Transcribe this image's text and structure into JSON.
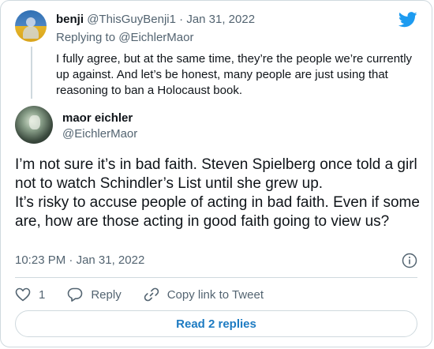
{
  "parent_tweet": {
    "name": "benji",
    "handle": "@ThisGuyBenji1",
    "separator": "·",
    "date": "Jan 31, 2022",
    "replying_label": "Replying to",
    "replying_handle": "@EichlerMaor",
    "text": "I fully agree, but at the same time, they’re the people we’re currently up against. And let’s be honest, many people are just using that reasoning to ban a Holocaust book."
  },
  "main_tweet": {
    "name": "maor eichler",
    "handle": "@EichlerMaor",
    "paragraphs": [
      "I’m not sure it’s in bad faith. Steven Spielberg once told a girl not to watch Schindler’s List until she grew up.",
      "It’s risky to accuse people of acting in bad faith. Even if some are, how are those acting in good faith going to view us?"
    ],
    "time": "10:23 PM",
    "separator": "·",
    "date": "Jan 31, 2022"
  },
  "actions": {
    "like_count": "1",
    "reply_label": "Reply",
    "copy_link_label": "Copy link to Tweet"
  },
  "read_replies_label": "Read 2 replies",
  "icons": {
    "brand": "twitter-bird-icon",
    "info": "info-icon",
    "like": "heart-icon",
    "reply": "reply-bubble-icon",
    "copy": "link-icon"
  },
  "colors": {
    "brand_blue": "#1d9bf0",
    "link_blue": "#1d7bc2",
    "muted": "#536471",
    "border": "#cfd9de"
  }
}
